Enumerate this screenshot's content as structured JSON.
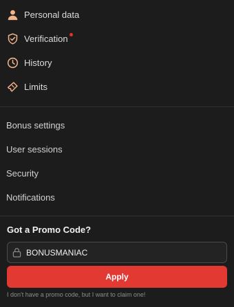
{
  "nav": {
    "items": [
      {
        "label": "Personal data",
        "icon": "user-icon"
      },
      {
        "label": "Verification",
        "icon": "shield-check-icon",
        "badge_dot": true
      },
      {
        "label": "History",
        "icon": "clock-icon"
      },
      {
        "label": "Limits",
        "icon": "ticket-icon"
      }
    ]
  },
  "settings": {
    "items": [
      {
        "label": "Bonus settings"
      },
      {
        "label": "User sessions"
      },
      {
        "label": "Security"
      },
      {
        "label": "Notifications"
      }
    ]
  },
  "promo": {
    "title": "Got a Promo Code?",
    "input_value": "BONUSMANIAC",
    "apply_label": "Apply",
    "claim_note": "I don't have a promo code, but I want to claim one!"
  },
  "colors": {
    "accent": "#e23a33",
    "icon_peach": "#f2b28c",
    "background": "#1c1c1c"
  }
}
